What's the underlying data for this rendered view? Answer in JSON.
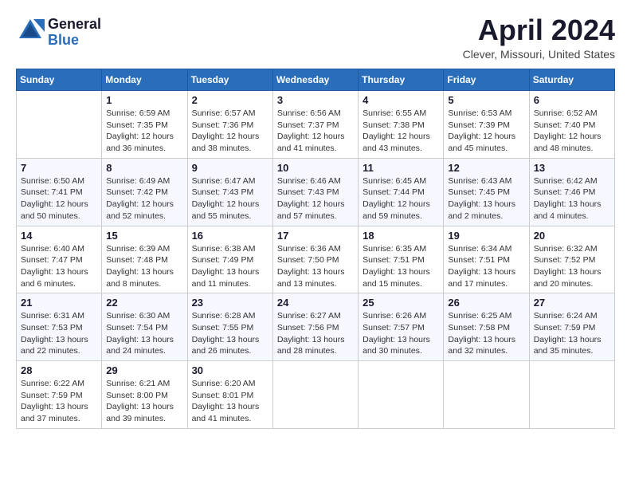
{
  "logo": {
    "general": "General",
    "blue": "Blue"
  },
  "title": "April 2024",
  "location": "Clever, Missouri, United States",
  "days_header": [
    "Sunday",
    "Monday",
    "Tuesday",
    "Wednesday",
    "Thursday",
    "Friday",
    "Saturday"
  ],
  "weeks": [
    [
      {
        "num": "",
        "info": ""
      },
      {
        "num": "1",
        "info": "Sunrise: 6:59 AM\nSunset: 7:35 PM\nDaylight: 12 hours\nand 36 minutes."
      },
      {
        "num": "2",
        "info": "Sunrise: 6:57 AM\nSunset: 7:36 PM\nDaylight: 12 hours\nand 38 minutes."
      },
      {
        "num": "3",
        "info": "Sunrise: 6:56 AM\nSunset: 7:37 PM\nDaylight: 12 hours\nand 41 minutes."
      },
      {
        "num": "4",
        "info": "Sunrise: 6:55 AM\nSunset: 7:38 PM\nDaylight: 12 hours\nand 43 minutes."
      },
      {
        "num": "5",
        "info": "Sunrise: 6:53 AM\nSunset: 7:39 PM\nDaylight: 12 hours\nand 45 minutes."
      },
      {
        "num": "6",
        "info": "Sunrise: 6:52 AM\nSunset: 7:40 PM\nDaylight: 12 hours\nand 48 minutes."
      }
    ],
    [
      {
        "num": "7",
        "info": "Sunrise: 6:50 AM\nSunset: 7:41 PM\nDaylight: 12 hours\nand 50 minutes."
      },
      {
        "num": "8",
        "info": "Sunrise: 6:49 AM\nSunset: 7:42 PM\nDaylight: 12 hours\nand 52 minutes."
      },
      {
        "num": "9",
        "info": "Sunrise: 6:47 AM\nSunset: 7:43 PM\nDaylight: 12 hours\nand 55 minutes."
      },
      {
        "num": "10",
        "info": "Sunrise: 6:46 AM\nSunset: 7:43 PM\nDaylight: 12 hours\nand 57 minutes."
      },
      {
        "num": "11",
        "info": "Sunrise: 6:45 AM\nSunset: 7:44 PM\nDaylight: 12 hours\nand 59 minutes."
      },
      {
        "num": "12",
        "info": "Sunrise: 6:43 AM\nSunset: 7:45 PM\nDaylight: 13 hours\nand 2 minutes."
      },
      {
        "num": "13",
        "info": "Sunrise: 6:42 AM\nSunset: 7:46 PM\nDaylight: 13 hours\nand 4 minutes."
      }
    ],
    [
      {
        "num": "14",
        "info": "Sunrise: 6:40 AM\nSunset: 7:47 PM\nDaylight: 13 hours\nand 6 minutes."
      },
      {
        "num": "15",
        "info": "Sunrise: 6:39 AM\nSunset: 7:48 PM\nDaylight: 13 hours\nand 8 minutes."
      },
      {
        "num": "16",
        "info": "Sunrise: 6:38 AM\nSunset: 7:49 PM\nDaylight: 13 hours\nand 11 minutes."
      },
      {
        "num": "17",
        "info": "Sunrise: 6:36 AM\nSunset: 7:50 PM\nDaylight: 13 hours\nand 13 minutes."
      },
      {
        "num": "18",
        "info": "Sunrise: 6:35 AM\nSunset: 7:51 PM\nDaylight: 13 hours\nand 15 minutes."
      },
      {
        "num": "19",
        "info": "Sunrise: 6:34 AM\nSunset: 7:51 PM\nDaylight: 13 hours\nand 17 minutes."
      },
      {
        "num": "20",
        "info": "Sunrise: 6:32 AM\nSunset: 7:52 PM\nDaylight: 13 hours\nand 20 minutes."
      }
    ],
    [
      {
        "num": "21",
        "info": "Sunrise: 6:31 AM\nSunset: 7:53 PM\nDaylight: 13 hours\nand 22 minutes."
      },
      {
        "num": "22",
        "info": "Sunrise: 6:30 AM\nSunset: 7:54 PM\nDaylight: 13 hours\nand 24 minutes."
      },
      {
        "num": "23",
        "info": "Sunrise: 6:28 AM\nSunset: 7:55 PM\nDaylight: 13 hours\nand 26 minutes."
      },
      {
        "num": "24",
        "info": "Sunrise: 6:27 AM\nSunset: 7:56 PM\nDaylight: 13 hours\nand 28 minutes."
      },
      {
        "num": "25",
        "info": "Sunrise: 6:26 AM\nSunset: 7:57 PM\nDaylight: 13 hours\nand 30 minutes."
      },
      {
        "num": "26",
        "info": "Sunrise: 6:25 AM\nSunset: 7:58 PM\nDaylight: 13 hours\nand 32 minutes."
      },
      {
        "num": "27",
        "info": "Sunrise: 6:24 AM\nSunset: 7:59 PM\nDaylight: 13 hours\nand 35 minutes."
      }
    ],
    [
      {
        "num": "28",
        "info": "Sunrise: 6:22 AM\nSunset: 7:59 PM\nDaylight: 13 hours\nand 37 minutes."
      },
      {
        "num": "29",
        "info": "Sunrise: 6:21 AM\nSunset: 8:00 PM\nDaylight: 13 hours\nand 39 minutes."
      },
      {
        "num": "30",
        "info": "Sunrise: 6:20 AM\nSunset: 8:01 PM\nDaylight: 13 hours\nand 41 minutes."
      },
      {
        "num": "",
        "info": ""
      },
      {
        "num": "",
        "info": ""
      },
      {
        "num": "",
        "info": ""
      },
      {
        "num": "",
        "info": ""
      }
    ]
  ]
}
